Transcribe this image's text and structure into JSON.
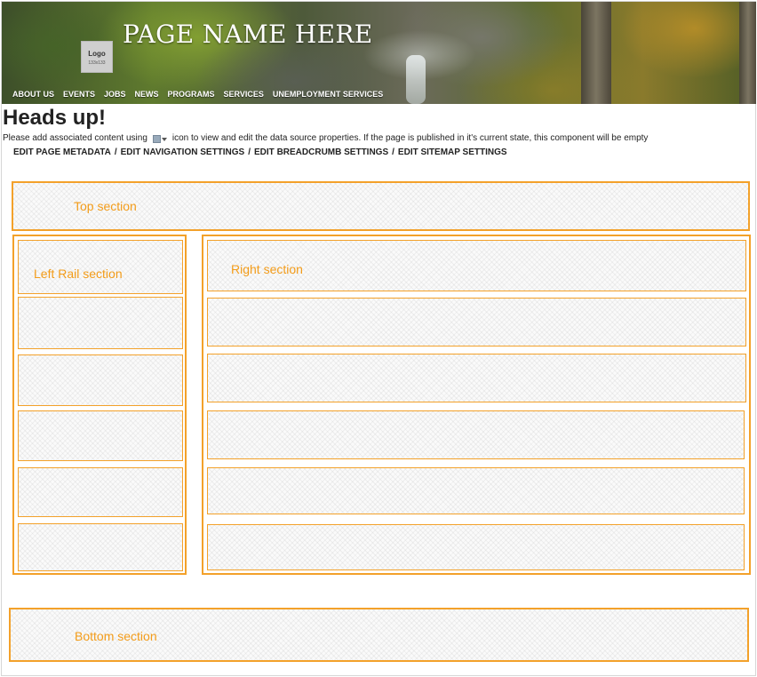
{
  "header": {
    "page_name": "PAGE NAME HERE",
    "logo": {
      "label": "Logo",
      "size_text": "133x133"
    },
    "nav": [
      {
        "label": "ABOUT US"
      },
      {
        "label": "EVENTS"
      },
      {
        "label": "JOBS"
      },
      {
        "label": "NEWS"
      },
      {
        "label": "PROGRAMS"
      },
      {
        "label": "SERVICES"
      },
      {
        "label": "UNEMPLOYMENT SERVICES"
      }
    ]
  },
  "notice": {
    "title": "Heads up!",
    "before_icon": "Please add associated content using",
    "icon": "data-source-icon",
    "after_icon": "icon to view and edit the data source properties. If the page is published in it's current state, this component will be empty"
  },
  "edit_links": {
    "items": [
      {
        "label": "EDIT PAGE METADATA"
      },
      {
        "label": "EDIT NAVIGATION SETTINGS"
      },
      {
        "label": "EDIT BREADCRUMB SETTINGS"
      },
      {
        "label": "EDIT SITEMAP SETTINGS"
      }
    ],
    "separator": "/"
  },
  "sections": {
    "top": "Top section",
    "left_rail": "Left Rail section",
    "right": "Right section",
    "bottom": "Bottom section"
  },
  "colors": {
    "accent": "#f3a12a",
    "label": "#f39c19"
  }
}
